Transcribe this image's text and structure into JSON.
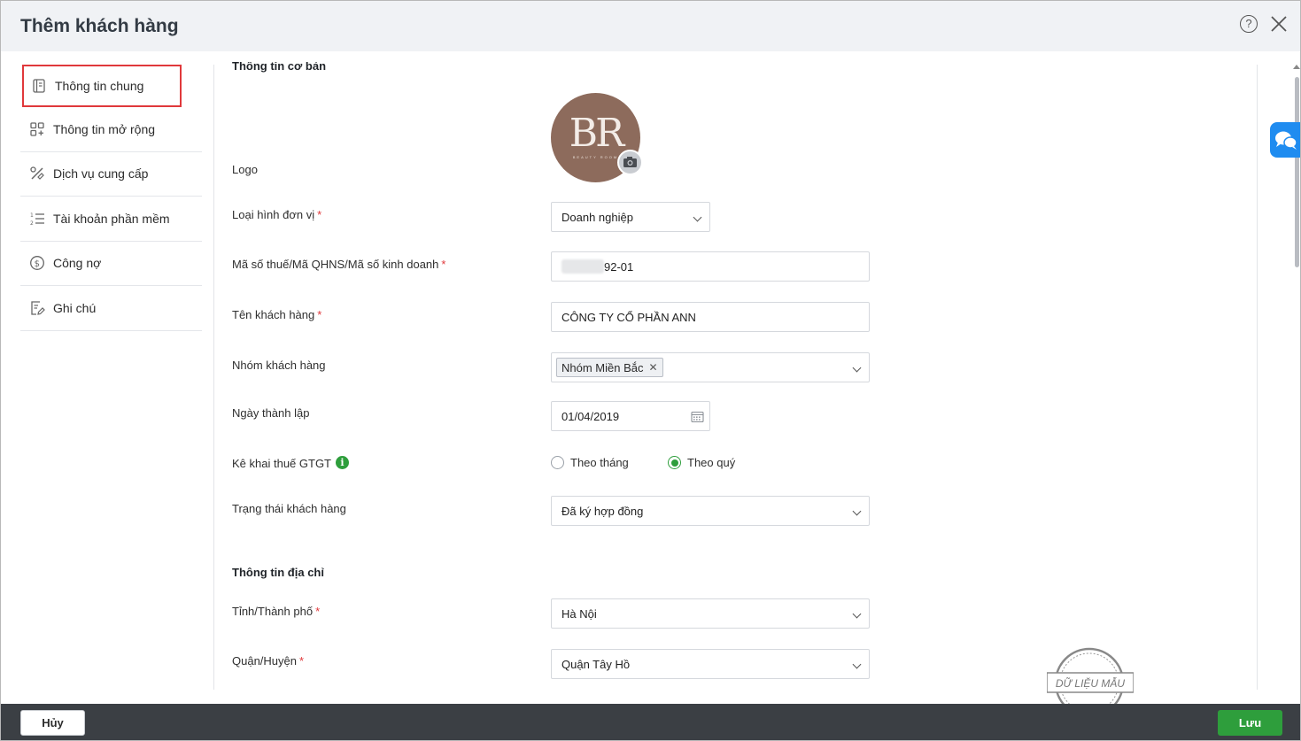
{
  "window": {
    "title": "Thêm khách hàng"
  },
  "sidebar": {
    "items": [
      {
        "label": "Thông tin chung",
        "icon": "document-icon",
        "active": true
      },
      {
        "label": "Thông tin mở rộng",
        "icon": "grid-plus-icon"
      },
      {
        "label": "Dịch vụ cung cấp",
        "icon": "tools-icon"
      },
      {
        "label": "Tài khoản phần mềm",
        "icon": "numbered-list-icon"
      },
      {
        "label": "Công nợ",
        "icon": "dollar-circle-icon"
      },
      {
        "label": "Ghi chú",
        "icon": "note-edit-icon"
      }
    ]
  },
  "form": {
    "basic_section": "Thông tin cơ bản",
    "logo_label": "Logo",
    "logo_text": "BR",
    "logo_subtext": "BEAUTY ROOM",
    "unit_type_label": "Loại hình đơn vị",
    "unit_type_value": "Doanh nghiệp",
    "tax_code_label": "Mã số thuế/Mã QHNS/Mã số kinh doanh",
    "tax_code_value": "92-01",
    "customer_name_label": "Tên khách hàng",
    "customer_name_value": "CÔNG TY CỔ PHẦN ANN",
    "customer_group_label": "Nhóm khách hàng",
    "customer_group_tag": "Nhóm Miền Bắc",
    "founded_label": "Ngày thành lập",
    "founded_value": "01/04/2019",
    "vat_label": "Kê khai thuế GTGT",
    "vat_options": [
      {
        "label": "Theo tháng",
        "selected": false
      },
      {
        "label": "Theo quý",
        "selected": true
      }
    ],
    "status_label": "Trạng thái khách hàng",
    "status_value": "Đã ký hợp đồng",
    "address_section": "Thông tin địa chỉ",
    "province_label": "Tỉnh/Thành phố",
    "province_value": "Hà Nội",
    "district_label": "Quận/Huyện",
    "district_value": "Quận Tây Hồ",
    "required_mark": "*"
  },
  "watermark": {
    "text": "DỮ LIỆU MẪU"
  },
  "footer": {
    "cancel_label": "Hủy",
    "save_label": "Lưu"
  },
  "colors": {
    "accent_green": "#2e9e3c",
    "active_border": "#e0383b",
    "footer_bg": "#3b3f44",
    "chat_blue": "#1f8cf0"
  }
}
